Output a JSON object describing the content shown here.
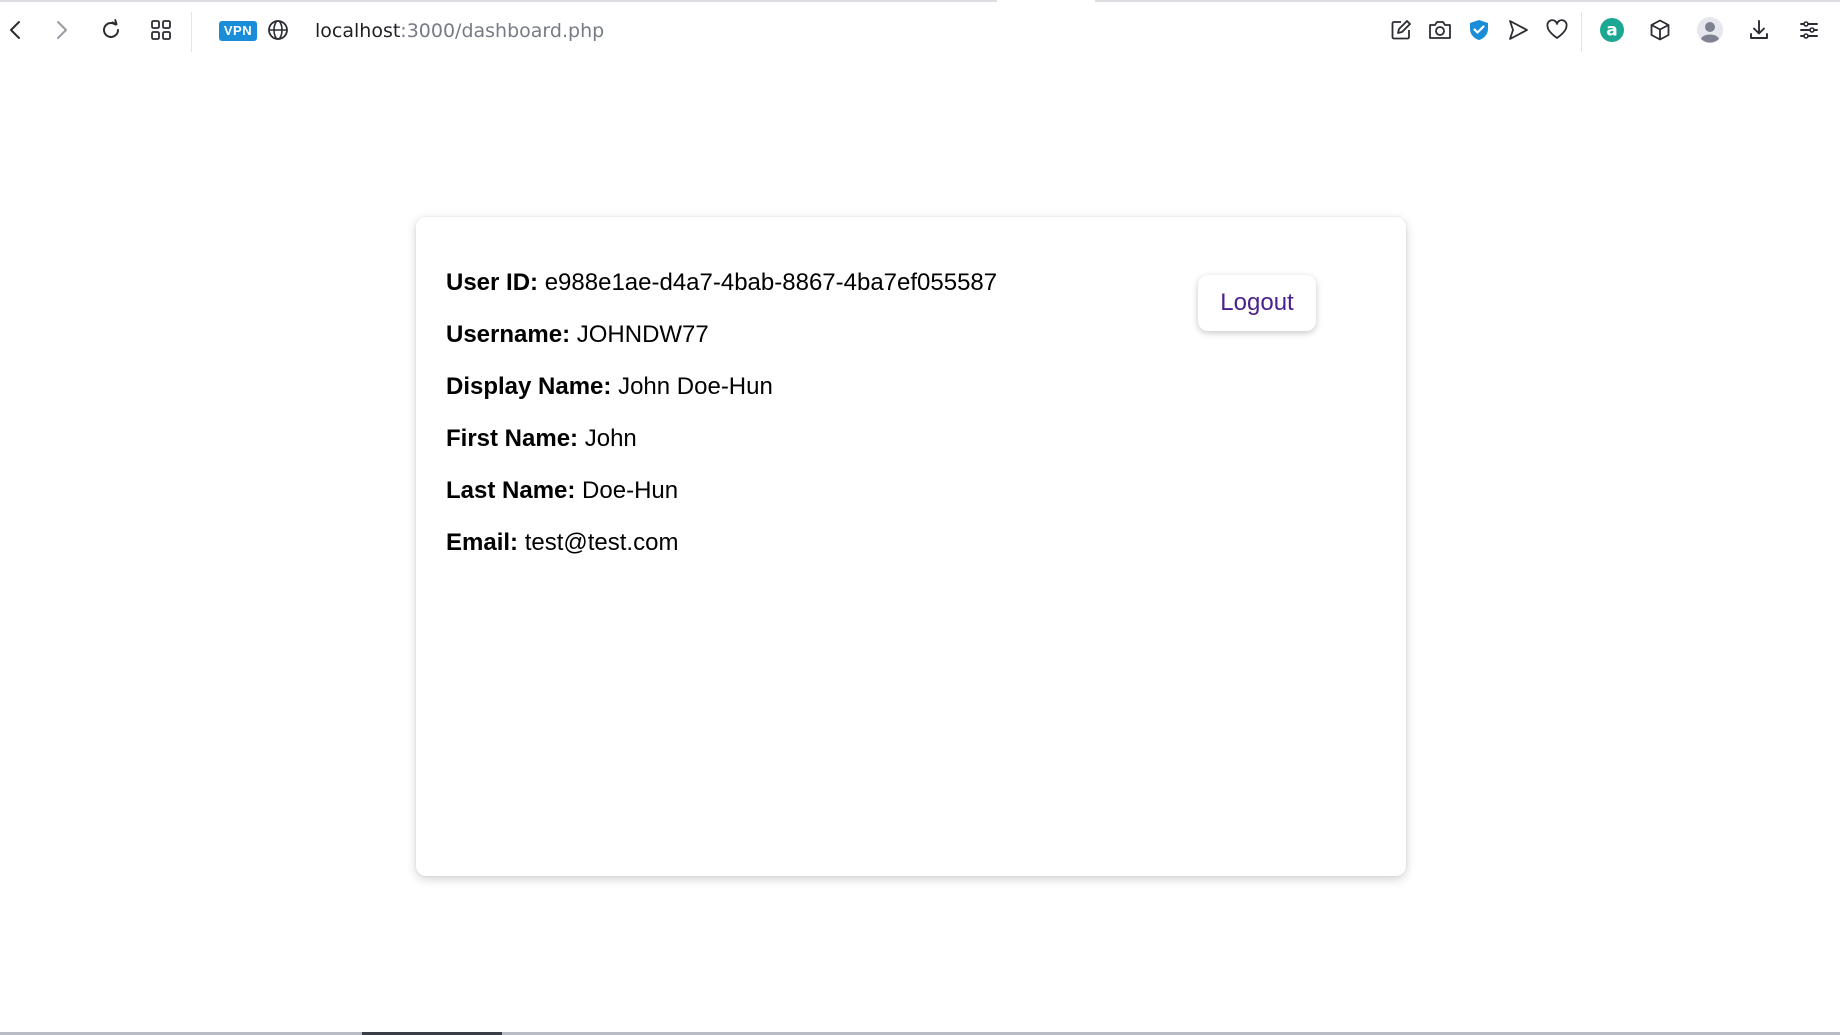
{
  "browser": {
    "vpn_label": "VPN",
    "url_host": "localhost",
    "url_path": ":3000/dashboard.php",
    "icons": [
      "back-icon",
      "forward-icon",
      "reload-icon",
      "tabs-grid-icon",
      "globe-icon",
      "edit-icon",
      "camera-icon",
      "shield-icon",
      "send-icon",
      "heart-icon",
      "extension-a-icon",
      "cube-icon",
      "profile-icon",
      "download-icon",
      "menu-icon"
    ],
    "accent_color": "#1a8dd8"
  },
  "profile": {
    "fields": [
      {
        "label": "User ID:",
        "value": "e988e1ae-d4a7-4bab-8867-4ba7ef055587"
      },
      {
        "label": "Username:",
        "value": "JOHNDW77"
      },
      {
        "label": "Display Name:",
        "value": "John Doe-Hun"
      },
      {
        "label": "First Name:",
        "value": "John"
      },
      {
        "label": "Last Name:",
        "value": "Doe-Hun"
      },
      {
        "label": "Email:",
        "value": "test@test.com"
      }
    ],
    "logout_label": "Logout",
    "logout_color": "#4a1f8f"
  }
}
